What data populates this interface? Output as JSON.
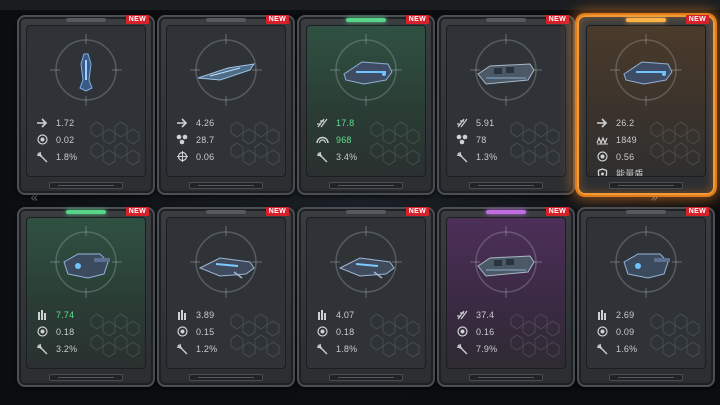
{
  "cards": [
    {
      "variant": "gray",
      "badge": "NEW",
      "ship": "ship-vertical",
      "stats": [
        {
          "icon": "arrow-icon",
          "value": "1.72"
        },
        {
          "icon": "target-icon",
          "value": "0.02"
        },
        {
          "icon": "missile-icon",
          "value": "1.8%"
        }
      ]
    },
    {
      "variant": "gray",
      "badge": "NEW",
      "ship": "ship-long",
      "stats": [
        {
          "icon": "arrow-icon",
          "value": "4.26"
        },
        {
          "icon": "cluster-icon",
          "value": "28.7"
        },
        {
          "icon": "crosshair-icon",
          "value": "0.06"
        }
      ]
    },
    {
      "variant": "green",
      "badge": "NEW",
      "ship": "ship-fighter",
      "stats": [
        {
          "icon": "bolt-icon",
          "value": "17.8",
          "highlight": true
        },
        {
          "icon": "dome-icon",
          "value": "968",
          "highlight": true
        },
        {
          "icon": "missile-icon",
          "value": "3.4%"
        }
      ]
    },
    {
      "variant": "gray",
      "badge": "NEW",
      "ship": "ship-cruiser",
      "stats": [
        {
          "icon": "bolt-icon",
          "value": "5.91"
        },
        {
          "icon": "cluster-icon",
          "value": "78"
        },
        {
          "icon": "missile-icon",
          "value": "1.3%"
        }
      ]
    },
    {
      "variant": "orange",
      "badge": "NEW",
      "ship": "ship-fighter",
      "stats": [
        {
          "icon": "arrow-icon",
          "value": "26.2"
        },
        {
          "icon": "wave-icon",
          "value": "1849"
        },
        {
          "icon": "target-icon",
          "value": "0.56"
        },
        {
          "icon": "shield-icon",
          "value": "能量盾"
        }
      ]
    },
    {
      "variant": "green",
      "badge": "NEW",
      "ship": "ship-gunship",
      "stats": [
        {
          "icon": "ammo-icon",
          "value": "7.74",
          "highlight": true
        },
        {
          "icon": "target-icon",
          "value": "0.18"
        },
        {
          "icon": "missile-icon",
          "value": "3.2%"
        }
      ]
    },
    {
      "variant": "gray",
      "badge": "NEW",
      "ship": "ship-wing",
      "stats": [
        {
          "icon": "ammo-icon",
          "value": "3.89"
        },
        {
          "icon": "target-icon",
          "value": "0.15"
        },
        {
          "icon": "missile-icon",
          "value": "1.2%"
        }
      ]
    },
    {
      "variant": "gray",
      "badge": "NEW",
      "ship": "ship-wing",
      "stats": [
        {
          "icon": "ammo-icon",
          "value": "4.07"
        },
        {
          "icon": "target-icon",
          "value": "0.18"
        },
        {
          "icon": "missile-icon",
          "value": "1.8%"
        }
      ]
    },
    {
      "variant": "purple",
      "badge": "NEW",
      "ship": "ship-cruiser",
      "stats": [
        {
          "icon": "bolt-icon",
          "value": "37.4"
        },
        {
          "icon": "target-icon",
          "value": "0.16"
        },
        {
          "icon": "missile-icon",
          "value": "7.9%"
        }
      ]
    },
    {
      "variant": "gray",
      "badge": "NEW",
      "ship": "ship-gunship",
      "stats": [
        {
          "icon": "ammo-icon",
          "value": "2.69"
        },
        {
          "icon": "target-icon",
          "value": "0.09"
        },
        {
          "icon": "missile-icon",
          "value": "1.6%"
        }
      ]
    }
  ]
}
